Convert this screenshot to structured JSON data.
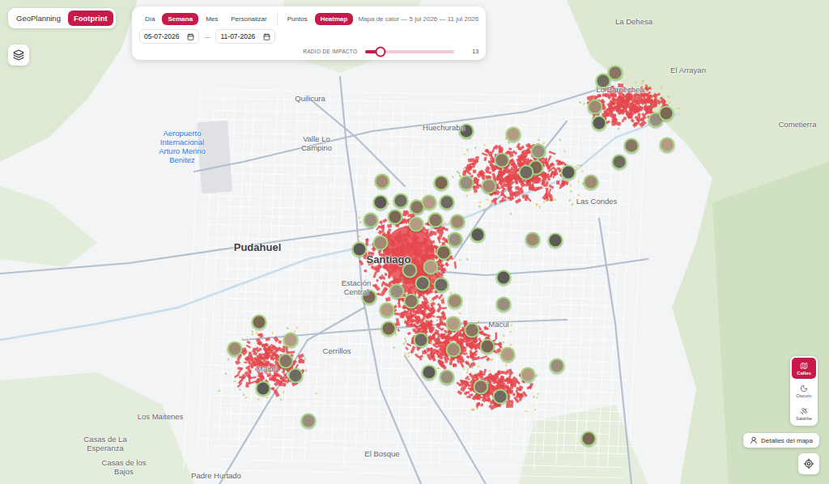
{
  "mode_tabs": [
    {
      "label": "GeoPlanning",
      "selected": false
    },
    {
      "label": "Footprint",
      "selected": true
    }
  ],
  "period_tabs": [
    {
      "label": "Día",
      "selected": false
    },
    {
      "label": "Semana",
      "selected": true
    },
    {
      "label": "Mes",
      "selected": false
    },
    {
      "label": "Personalizar",
      "selected": false
    }
  ],
  "view_tabs": [
    {
      "label": "Puntos",
      "selected": false
    },
    {
      "label": "Heatmap",
      "selected": true
    }
  ],
  "caption": "Mapa de calor — 5 jul 2026 — 11 jul 2026",
  "date_range": {
    "from": "05-07-2026",
    "separator": "—",
    "to": "11-07-2026"
  },
  "impact_radius": {
    "label": "RADIO DE IMPACTO",
    "level": 0.17,
    "value": "13"
  },
  "map_styles": [
    {
      "label": "Calles",
      "selected": true
    },
    {
      "label": "Oscuro",
      "selected": false
    },
    {
      "label": "Satélite",
      "selected": false
    }
  ],
  "details_button": "Detalles del mapa",
  "place_labels": [
    {
      "text": "La Dehesa",
      "kind": "place"
    },
    {
      "text": "El Arrayan",
      "kind": "place"
    },
    {
      "text": "Cometierra",
      "kind": "place"
    },
    {
      "text": "Quilicura",
      "kind": "place"
    },
    {
      "text": "Huechuraba",
      "kind": "place"
    },
    {
      "text": "Valle Lo Campino",
      "kind": "place"
    },
    {
      "text": "Aeropuerto Internacional Arturo Merino Benitez",
      "kind": "airport"
    },
    {
      "text": "Lo Barnechea",
      "kind": "place"
    },
    {
      "text": "Las Condes",
      "kind": "place"
    },
    {
      "text": "Pudahuel",
      "kind": "major"
    },
    {
      "text": "Santiago",
      "kind": "major"
    },
    {
      "text": "Estación Central",
      "kind": "place"
    },
    {
      "text": "Macul",
      "kind": "place"
    },
    {
      "text": "Cerrillos",
      "kind": "place"
    },
    {
      "text": "Maipú",
      "kind": "place"
    },
    {
      "text": "Los Maitenes",
      "kind": "place"
    },
    {
      "text": "Casas de La Esperanza",
      "kind": "place"
    },
    {
      "text": "Casas de los Bajos",
      "kind": "place"
    },
    {
      "text": "Padre Hurtado",
      "kind": "place"
    },
    {
      "text": "El Bosque",
      "kind": "place"
    }
  ]
}
